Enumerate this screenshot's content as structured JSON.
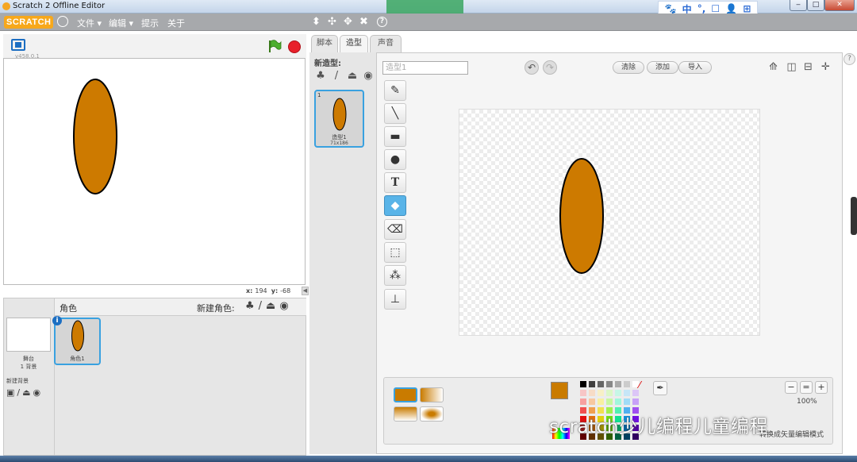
{
  "window": {
    "title": "Scratch 2 Offline Editor",
    "minimize": "‒",
    "maximize": "□",
    "close": "✕"
  },
  "ime": {
    "items": [
      "🐾",
      "中",
      "°,",
      "☐",
      "👤",
      "⊞"
    ]
  },
  "menubar": {
    "logo": "SCRATCH",
    "items": [
      "文件 ▾",
      "编辑 ▾",
      "提示",
      "关于"
    ],
    "tools": [
      "⬍",
      "✣",
      "✥",
      "✖",
      "?"
    ]
  },
  "stage": {
    "version": "v458.0.1",
    "x_label": "x:",
    "x_value": "194",
    "y_label": "y:",
    "y_value": "-68"
  },
  "sprites": {
    "header_label": "角色",
    "new_sprite_label": "新建角色:",
    "backdrop_label": "舞台",
    "backdrop_count": "1 背景",
    "new_backdrop_label": "新建背景",
    "sprite_name": "角色1"
  },
  "tabs": [
    "脚本",
    "造型",
    "声音"
  ],
  "costumes": {
    "new_costume_label": "新造型:",
    "card_index": "1",
    "card_name": "造型1",
    "card_size": "71x186"
  },
  "paint": {
    "name_placeholder": "造型1",
    "clear": "清除",
    "add": "添加",
    "import": "导入",
    "zoom_level": "100%",
    "bitmap_mode": "转换成矢量编辑模式",
    "fill_color": "#c97b00",
    "sprite_color": "#cd7a00"
  },
  "colors": {
    "accent": "#39a1e0",
    "palette": [
      "#000000",
      "#404040",
      "#666666",
      "#888888",
      "#aaaaaa",
      "#cccccc",
      "#ffffff",
      "#f7c6c6",
      "#f7dcc6",
      "#f7f0c6",
      "#dcf7c6",
      "#c6f7e6",
      "#c6e6f7",
      "#dcc6f7",
      "#f7a0a0",
      "#f7c8a0",
      "#f7f0a0",
      "#c8f7a0",
      "#a0f7dc",
      "#a0dcf7",
      "#c8a0f7",
      "#f05050",
      "#f0a050",
      "#f0e050",
      "#a0f050",
      "#50f0b0",
      "#50b0f0",
      "#a050f0",
      "#e01010",
      "#e07010",
      "#e0d010",
      "#70e010",
      "#10e090",
      "#1090e0",
      "#7010e0",
      "#a00000",
      "#a05000",
      "#a09000",
      "#50a000",
      "#00a060",
      "#0060a0",
      "#5000a0",
      "#600000",
      "#603000",
      "#605000",
      "#306000",
      "#006040",
      "#004060",
      "#300060"
    ]
  },
  "watermark": "scratch少儿编程儿童编程"
}
